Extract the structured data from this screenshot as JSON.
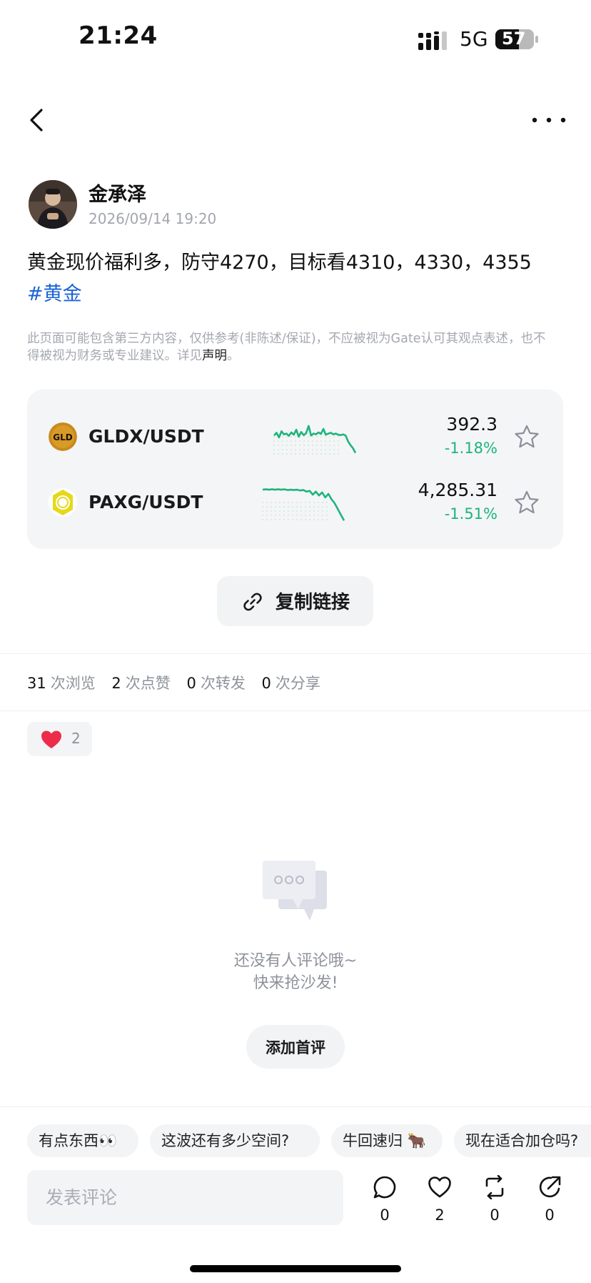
{
  "status_bar": {
    "time": "21:24",
    "network": "5G",
    "battery": "57"
  },
  "author": {
    "name": "金承泽",
    "time": "2026/09/14 19:20"
  },
  "post": {
    "text": "黄金现价福利多，防守4270，目标看4310，4330，4355",
    "hashtag": "#黄金"
  },
  "disclaimer": {
    "text": "此页面可能包含第三方内容，仅供参考(非陈述/保证)，不应被视为Gate认可其观点表述，也不得被视为财务或专业建议。详见",
    "link": "声明",
    "end": "。"
  },
  "markets": [
    {
      "icon": "gld-coin-icon",
      "icon_text": "GLD",
      "pair": "GLDX/USDT",
      "price": "392.3",
      "change": "-1.18%",
      "trend": [
        0.55,
        0.62,
        0.5,
        0.66,
        0.58,
        0.6,
        0.54,
        0.63,
        0.57,
        0.7,
        0.52,
        0.64,
        0.56,
        0.61,
        0.8,
        0.55,
        0.6,
        0.58,
        0.63,
        0.59,
        0.72,
        0.57,
        0.6,
        0.62,
        0.58,
        0.6,
        0.57,
        0.56,
        0.58,
        0.55,
        0.4,
        0.3,
        0.22,
        0.1
      ]
    },
    {
      "icon": "paxg-coin-icon",
      "pair": "PAXG/USDT",
      "price": "4,285.31",
      "change": "-1.51%",
      "trend": [
        0.85,
        0.86,
        0.85,
        0.86,
        0.85,
        0.86,
        0.85,
        0.86,
        0.84,
        0.85,
        0.84,
        0.85,
        0.83,
        0.84,
        0.8,
        0.82,
        0.72,
        0.8,
        0.7,
        0.78,
        0.65,
        0.74,
        0.6,
        0.5,
        0.35,
        0.2,
        0.05
      ]
    }
  ],
  "copy_link": {
    "label": "复制链接"
  },
  "stats": [
    {
      "count": "31",
      "label": "次浏览"
    },
    {
      "count": "2",
      "label": "次点赞"
    },
    {
      "count": "0",
      "label": "次转发"
    },
    {
      "count": "0",
      "label": "次分享"
    }
  ],
  "reaction": {
    "count": "2"
  },
  "empty_state": {
    "line1": "还没有人评论哦~",
    "line2": "快来抢沙发!",
    "button": "添加首评"
  },
  "quick_replies": [
    "有点东西👀",
    "这波还有多少空间?",
    "牛回速归 🐂",
    "现在适合加仓吗?"
  ],
  "comment_input": {
    "placeholder": "发表评论"
  },
  "actions": [
    {
      "name": "comment",
      "count": "0"
    },
    {
      "name": "like",
      "count": "2"
    },
    {
      "name": "repost",
      "count": "0"
    },
    {
      "name": "share",
      "count": "0"
    }
  ],
  "colors": {
    "up_down_green": "#1db47a",
    "hashtag_blue": "#1b63d6"
  }
}
